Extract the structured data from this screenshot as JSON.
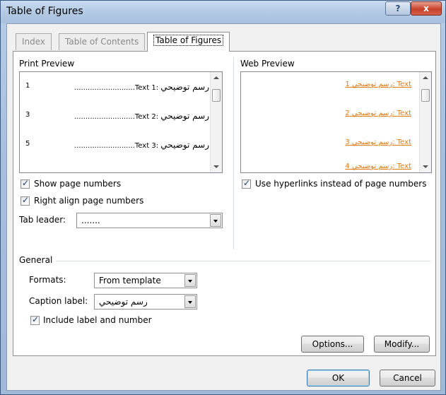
{
  "window": {
    "title": "Table of Figures",
    "help": "?",
    "close": "x"
  },
  "tabs": [
    {
      "label": "Index"
    },
    {
      "label": "Table of Contents"
    },
    {
      "label": "Table of Figures"
    }
  ],
  "print_preview": {
    "heading": "Print Preview",
    "lines": [
      {
        "caption": "رسم توضيحي",
        "num": "1",
        "text": "Text",
        "page": "1",
        "dots": "..........................."
      },
      {
        "caption": "رسم توضيحي",
        "num": "2",
        "text": "Text",
        "page": "3",
        "dots": "..........................."
      },
      {
        "caption": "رسم توضيحي",
        "num": "3",
        "text": "Text",
        "page": "5",
        "dots": "..........................."
      }
    ]
  },
  "web_preview": {
    "heading": "Web Preview",
    "lines": [
      "رسم توضيحي 1: Text",
      "رسم توضيحي 2: Text",
      "رسم توضيحي 3: Text",
      "رسم توضيحي 4: Text"
    ]
  },
  "options": {
    "show_page_numbers": {
      "label": "Show page numbers",
      "checked": true
    },
    "right_align": {
      "label": "Right align page numbers",
      "checked": true
    },
    "tab_leader": {
      "label": "Tab leader:",
      "value": "......."
    },
    "use_hyperlinks": {
      "label": "Use hyperlinks instead of page numbers",
      "checked": true
    }
  },
  "general": {
    "heading": "General",
    "formats": {
      "label": "Formats:",
      "value": "From template"
    },
    "caption_label": {
      "label": "Caption label:",
      "value": "رسم توضيحي"
    },
    "include_label": {
      "label": "Include label and number",
      "checked": true
    }
  },
  "buttons": {
    "options": "Options...",
    "modify": "Modify...",
    "ok": "OK",
    "cancel": "Cancel"
  }
}
